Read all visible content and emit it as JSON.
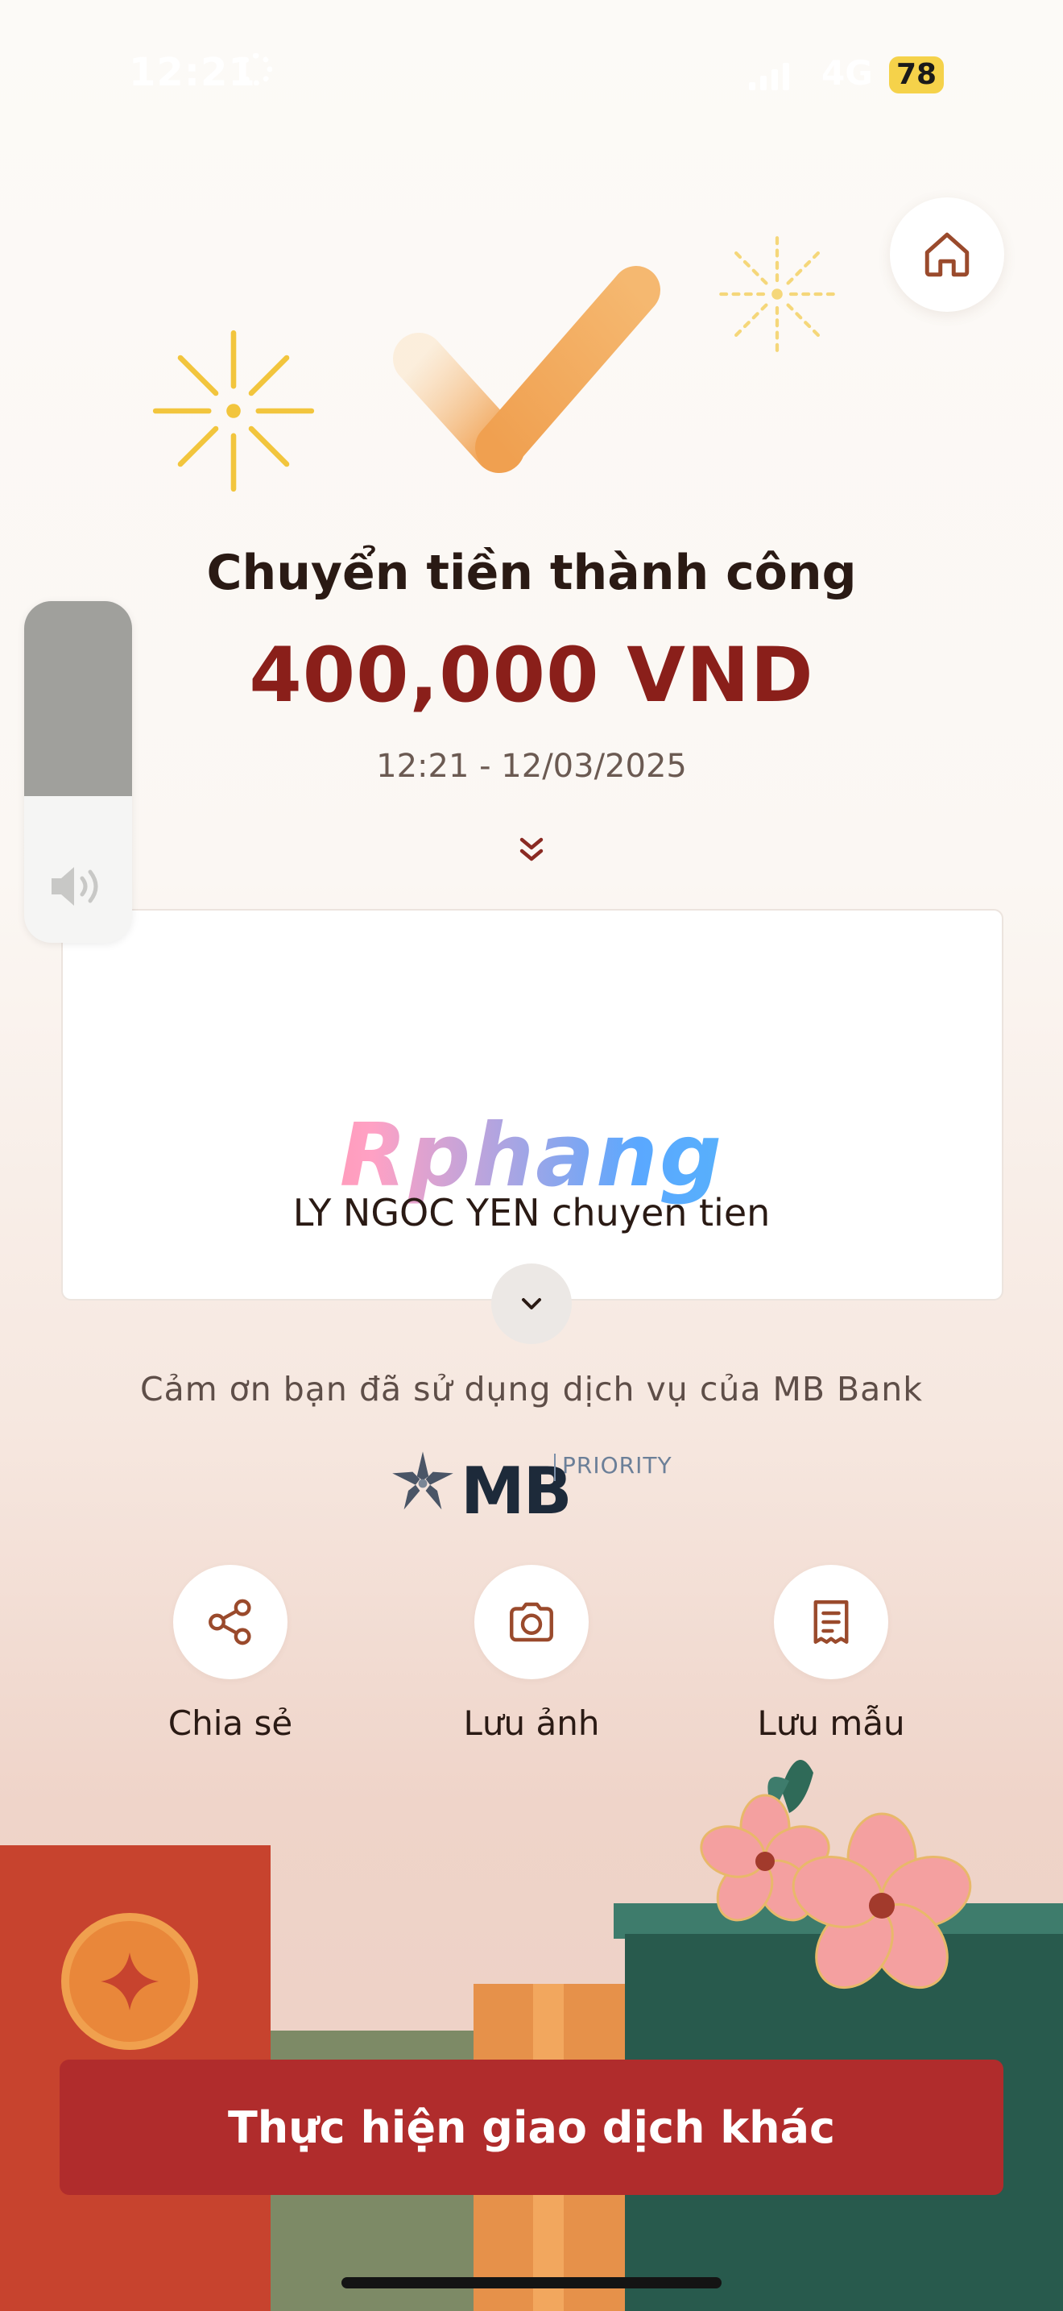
{
  "status_bar": {
    "time": "12:21",
    "network": "4G",
    "battery": "78"
  },
  "result": {
    "title": "Chuyển tiền thành công",
    "amount": "400,000 VND",
    "datetime": "12:21 - 12/03/2025"
  },
  "detail_card": {
    "watermark": "Rphang",
    "memo": "LY NGOC YEN chuyen tien"
  },
  "thanks_text": "Cảm ơn bạn đã sử dụng dịch vụ của MB Bank",
  "logo": {
    "brand": "MB",
    "tier": "PRIORITY"
  },
  "actions": [
    {
      "label": "Chia sẻ",
      "icon": "share-icon"
    },
    {
      "label": "Lưu ảnh",
      "icon": "camera-icon"
    },
    {
      "label": "Lưu mẫu",
      "icon": "receipt-icon"
    }
  ],
  "primary_button": "Thực hiện giao dịch khác",
  "volume_level": 0.57,
  "colors": {
    "amount": "#8a1f1a",
    "primary": "#b02c2c",
    "icon": "#9a4a2c",
    "check": "#f0a050"
  }
}
